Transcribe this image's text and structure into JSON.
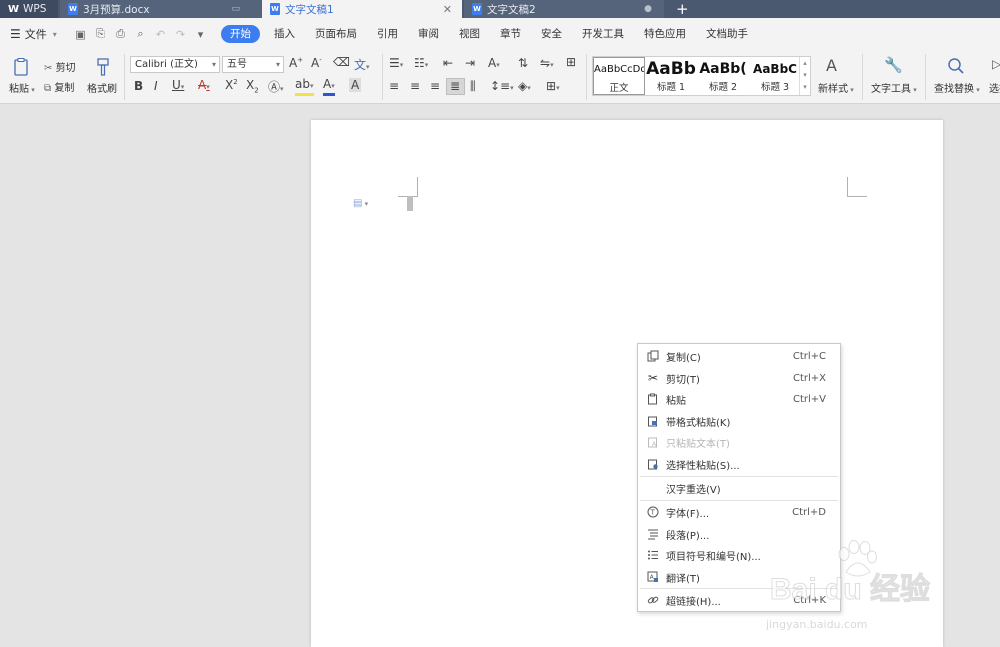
{
  "tabs": {
    "app": "WPS",
    "doc1": "3月预算.docx",
    "doc_active": "文字文稿1",
    "doc2": "文字文稿2",
    "new_tab": "+"
  },
  "menu": {
    "file": "文件",
    "tabs": [
      "开始",
      "插入",
      "页面布局",
      "引用",
      "审阅",
      "视图",
      "章节",
      "安全",
      "开发工具",
      "特色应用",
      "文档助手"
    ]
  },
  "ribbon": {
    "paste": "粘贴",
    "cut": "剪切",
    "copy": "复制",
    "format_painter": "格式刷",
    "font_name": "Calibri (正文)",
    "font_size": "五号",
    "new_style": "新样式",
    "text_tools": "文字工具",
    "find_replace": "查找替换",
    "select": "选择",
    "styles": [
      {
        "preview": "AaBbCcDd",
        "label": "正文"
      },
      {
        "preview": "AaBb",
        "label": "标题 1"
      },
      {
        "preview": "AaBb(",
        "label": "标题 2"
      },
      {
        "preview": "AaBbC",
        "label": "标题 3"
      }
    ]
  },
  "context_menu": {
    "items": [
      {
        "label": "复制(C)",
        "shortcut": "Ctrl+C",
        "icon": "copy-icon",
        "enabled": true
      },
      {
        "label": "剪切(T)",
        "shortcut": "Ctrl+X",
        "icon": "scissors-icon",
        "enabled": true
      },
      {
        "label": "粘贴",
        "shortcut": "Ctrl+V",
        "icon": "paste-icon",
        "enabled": true
      },
      {
        "label": "带格式粘贴(K)",
        "shortcut": "",
        "icon": "paste-format-icon",
        "enabled": true
      },
      {
        "label": "只粘贴文本(T)",
        "shortcut": "",
        "icon": "paste-text-icon",
        "enabled": false
      },
      {
        "label": "选择性粘贴(S)...",
        "shortcut": "",
        "icon": "paste-special-icon",
        "enabled": true
      },
      {
        "label": "汉字重选(V)",
        "shortcut": "",
        "icon": "",
        "enabled": true
      },
      {
        "label": "字体(F)...",
        "shortcut": "Ctrl+D",
        "icon": "font-icon",
        "enabled": true
      },
      {
        "label": "段落(P)...",
        "shortcut": "",
        "icon": "paragraph-icon",
        "enabled": true
      },
      {
        "label": "项目符号和编号(N)...",
        "shortcut": "",
        "icon": "bullets-icon",
        "enabled": true
      },
      {
        "label": "翻译(T)",
        "shortcut": "",
        "icon": "translate-icon",
        "enabled": true
      },
      {
        "label": "超链接(H)...",
        "shortcut": "Ctrl+K",
        "icon": "hyperlink-icon",
        "enabled": true
      }
    ]
  },
  "watermark": {
    "brand": "Bai du 经验",
    "url": "jingyan.baidu.com"
  }
}
